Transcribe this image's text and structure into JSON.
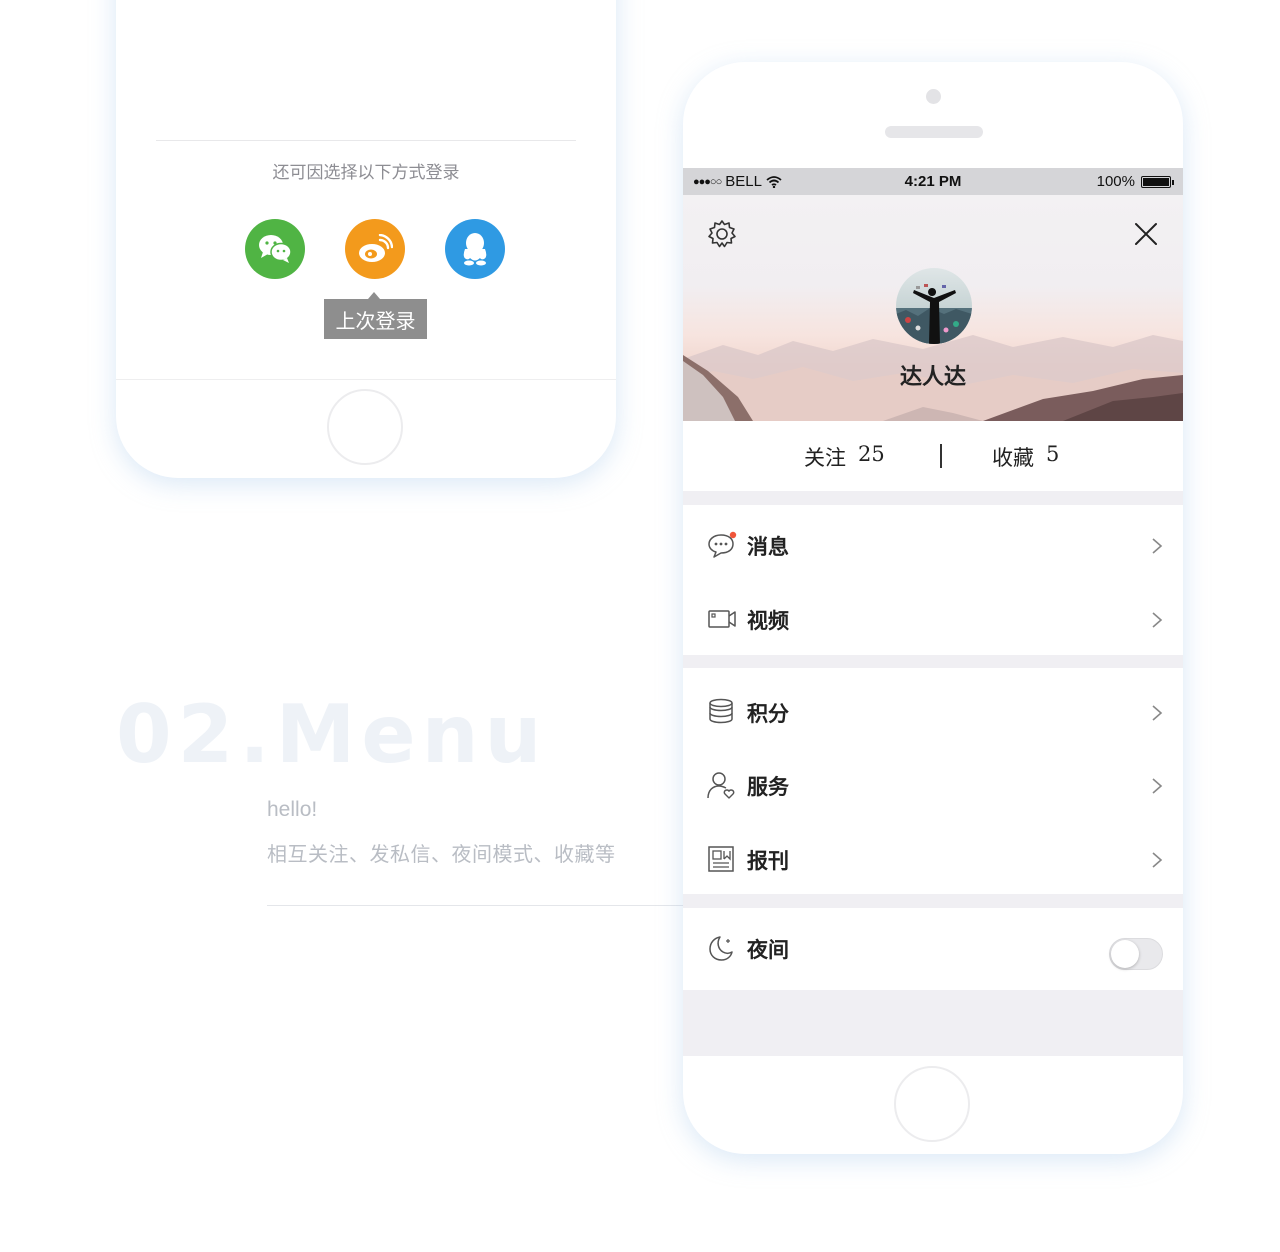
{
  "login_phone": {
    "alt_login_text": "还可因选择以下方式登录",
    "social_buttons": [
      {
        "name": "wechat",
        "color": "#50b444",
        "icon": "wechat-icon"
      },
      {
        "name": "weibo",
        "color": "#f39a1c",
        "icon": "weibo-icon"
      },
      {
        "name": "qq",
        "color": "#2f9ae3",
        "icon": "qq-icon"
      }
    ],
    "last_login_tooltip": "上次登录"
  },
  "section": {
    "title": "02.Menu",
    "greeting": "hello!",
    "description": "相互关注、发私信、夜间模式、收藏等"
  },
  "profile_phone": {
    "status_bar": {
      "carrier": "BELL",
      "signal": "●●●○○",
      "time": "4:21 PM",
      "battery": "100%"
    },
    "header": {
      "settings_icon": "gear-icon",
      "close_icon": "close-icon",
      "username": "达人达"
    },
    "stats": {
      "follow_label": "关注",
      "follow_count": "25",
      "favorites_label": "收藏",
      "favorites_count": "5"
    },
    "menu": [
      {
        "label": "消息",
        "icon": "message-icon",
        "badge_color": "#f0553a"
      },
      {
        "label": "视频",
        "icon": "video-icon"
      },
      {
        "label": "积分",
        "icon": "coins-icon"
      },
      {
        "label": "服务",
        "icon": "user-service-icon"
      },
      {
        "label": "报刊",
        "icon": "newspaper-icon"
      }
    ],
    "night_mode": {
      "label": "夜间",
      "icon": "moon-icon",
      "enabled": false
    }
  },
  "colors": {
    "accent_green": "#50b444",
    "accent_orange": "#f39a1c",
    "accent_blue": "#2f9ae3",
    "background_gray": "#f0eff3"
  }
}
